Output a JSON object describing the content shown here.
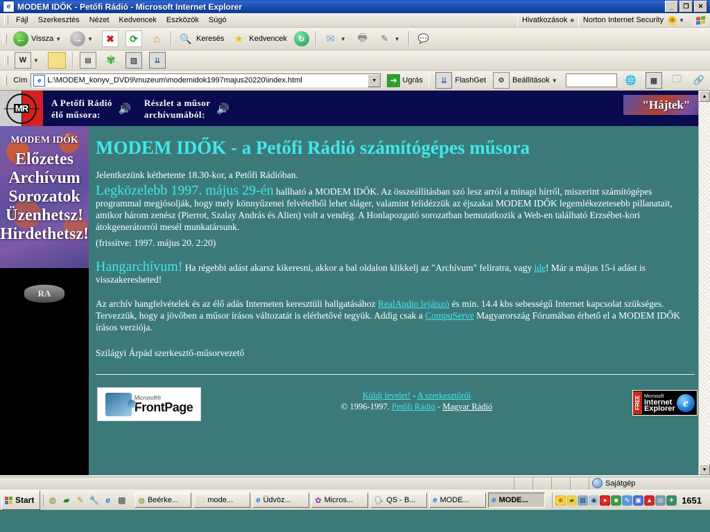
{
  "window": {
    "title": "MODEM IDŐK - Petőfi Rádió - Microsoft Internet Explorer",
    "icon": "ie-document-icon",
    "minimize": "_",
    "maximize": "❐",
    "close": "✕"
  },
  "menu": {
    "items": [
      "Fájl",
      "Szerkesztés",
      "Nézet",
      "Kedvencek",
      "Eszközök",
      "Súgó"
    ],
    "links_label": "Hivatkozások",
    "links_chevron": "»",
    "norton_label": "Norton Internet Security"
  },
  "toolbar": {
    "back": "Vissza",
    "forward": "",
    "stop": "",
    "refresh": "",
    "home": "",
    "search": "Keresés",
    "favorites": "Kedvencek",
    "history": "",
    "mail": "",
    "print": "",
    "edit": ""
  },
  "address": {
    "label": "Cím",
    "value": "L:\\MODEM_konyv_DVD9\\muzeum\\modemidok1997majus20220\\index.html",
    "go_label": "Ugrás",
    "flashget_label": "FlashGet",
    "settings_label": "Beállítások",
    "search_value": ""
  },
  "banner": {
    "logo_text": "MR",
    "left_line1": "A Petőfi Rádió",
    "left_line2": "élő műsora:",
    "right_line1": "Részlet a műsor",
    "right_line2": "archívumából:",
    "speaker_icon": "🔊",
    "hajtek": "\"Hájtek\""
  },
  "sidebar": {
    "title": "MODEM IDŐK",
    "items": [
      "Előzetes",
      "Archívum",
      "Sorozatok",
      "Üzenhetsz!",
      "Hirdethetsz!"
    ],
    "realaudio_logo": "RA"
  },
  "main": {
    "heading": "MODEM IDŐK - a Petőfi Rádió számítógépes műsora",
    "intro": "Jelentkezünk kéthetente 18.30-kor, a Petőfi Rádióban.",
    "next_highlight": "Legközelebb 1997. május 29-én",
    "next_body": " hallható a MODEM IDŐK. Az összeállításban szó lesz arról a minapi hírről, miszerint számítógépes programmal megjósolják, hogy mely könnyűzenei felvételből lehet sláger, valamint felidézzük az éjszakai MODEM IDŐK legemlékezetesebb pillanatait, amikor három zenész (Pierrot, Szalay András és Alien) volt a vendég. A Honlapozgató sorozatban bemutatkozik a Web-en található Erzsébet-kori átokgenerátorról mesél munkatársunk.",
    "updated": "(frissítve: 1997. május 20. 2:20)",
    "archive_highlight": "Hangarchívum!",
    "archive_body_1": " Ha régebbi adást akarsz kikeresni, akkor a bal oldalon klikkelj az \"Archívum\" feliratra, vagy ",
    "archive_link": "ide",
    "archive_body_2": "! Már a május 15-i adást is visszakeresheted!",
    "tech_1": "Az archív hangfelvételek és az élő adás Interneten keresztüli hallgatásához ",
    "tech_link_1": "RealAudio lejátszó",
    "tech_2": " és min. 14.4 kbs sebességű Internet kapcsolat szükséges. Tervezzük, hogy a jövőben a műsor írásos változatát is elérhetővé tegyük. Addig csak a ",
    "tech_link_2": "CompuServe",
    "tech_3": " Magyarország Fórumában érhető el a MODEM IDŐK írásos verziója.",
    "signature": "Szilágyi Árpád szerkesztő-műsorvezető"
  },
  "footer": {
    "frontpage_ms": "Microsoft®",
    "frontpage_name": "FrontPage",
    "link_mail": "Küldj levelet!",
    "separator": " - ",
    "link_editor": "A szerkesztőről",
    "copyright": "© 1996-1997. ",
    "link_petofi": "Petőfi Rádió",
    "link_magyar": "Magyar Rádió",
    "ie_free": "FREE",
    "ie_ms": "Microsoft",
    "ie_internet": "Internet",
    "ie_explorer": "Explorer"
  },
  "statusbar": {
    "text": "",
    "zone": "Sajátgép"
  },
  "taskbar": {
    "start": "Start",
    "quicklaunch": [
      "clock-icon",
      "monitor-icon",
      "pencil-icon",
      "tool-icon",
      "ie-icon",
      "grid-icon"
    ],
    "tasks": [
      {
        "label": "Beérke...",
        "icon": "mail-clock-icon",
        "active": false
      },
      {
        "label": "mode...",
        "icon": "folder-icon",
        "active": false
      },
      {
        "label": "Üdvöz...",
        "icon": "ie-document-icon",
        "active": false
      },
      {
        "label": "Micros...",
        "icon": "palette-icon",
        "active": false
      },
      {
        "label": "QS - B...",
        "icon": "speaker-icon",
        "active": false
      },
      {
        "label": "MODE...",
        "icon": "ie-document-icon",
        "active": false
      },
      {
        "label": "MODE...",
        "icon": "ie-document-icon",
        "active": true
      }
    ],
    "clock": "1651"
  },
  "colors": {
    "page_bg": "#3c7a7a",
    "accent_cyan": "#42e8e8",
    "banner_bg": "#0a0a4e",
    "titlebar_blue": "#1b4ba8"
  }
}
